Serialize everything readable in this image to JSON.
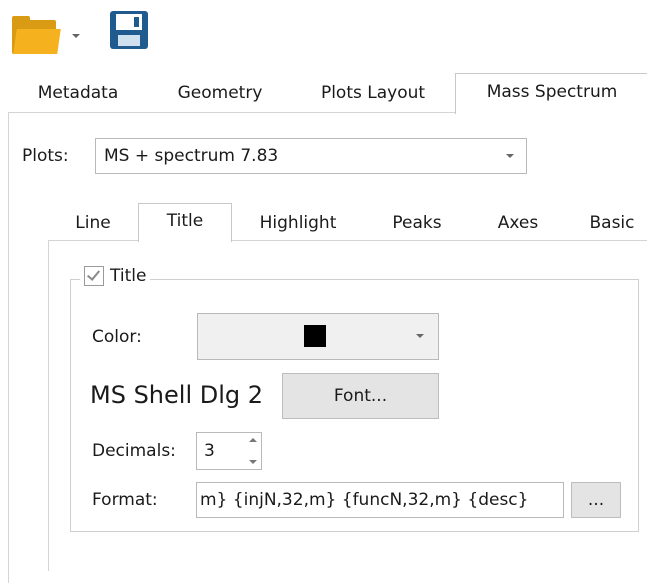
{
  "toolbar": {
    "open_icon": "folder-open-icon",
    "save_icon": "floppy-disk-icon"
  },
  "tabs": [
    {
      "label": "Metadata"
    },
    {
      "label": "Geometry"
    },
    {
      "label": "Plots Layout"
    },
    {
      "label": "Mass Spectrum",
      "selected": true
    }
  ],
  "plots": {
    "label": "Plots:",
    "value": "MS + spectrum 7.83"
  },
  "inner_tabs": [
    {
      "label": "Line"
    },
    {
      "label": "Title",
      "selected": true
    },
    {
      "label": "Highlight"
    },
    {
      "label": "Peaks"
    },
    {
      "label": "Axes"
    },
    {
      "label": "Basic"
    }
  ],
  "title_group": {
    "legend": "Title",
    "checked": true,
    "color_label": "Color:",
    "color_value": "#000000",
    "font_name": "MS Shell Dlg 2",
    "font_button": "Font...",
    "decimals_label": "Decimals:",
    "decimals_value": "3",
    "format_label": "Format:",
    "format_value": "m} {injN,32,m} {funcN,32,m} {desc}",
    "browse_button": "..."
  }
}
